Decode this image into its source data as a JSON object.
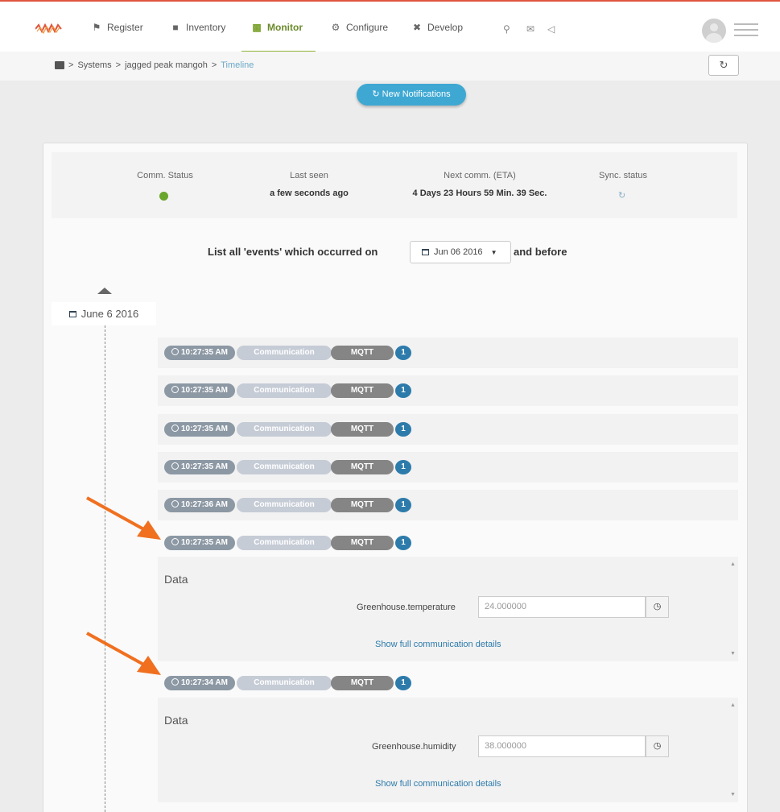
{
  "nav": {
    "items": [
      {
        "label": "Register",
        "icon": "flag-icon"
      },
      {
        "label": "Inventory",
        "icon": "box-icon"
      },
      {
        "label": "Monitor",
        "icon": "dashboard-icon"
      },
      {
        "label": "Configure",
        "icon": "gear-icon"
      },
      {
        "label": "Develop",
        "icon": "tools-icon"
      }
    ],
    "active": "Monitor",
    "accent": "#7ba22e"
  },
  "breadcrumb": {
    "sep": ">",
    "items": [
      "Systems",
      "jagged peak mangoh",
      "Timeline"
    ]
  },
  "notifications_button": "↻ New Notifications",
  "status": {
    "comm_label": "Comm. Status",
    "last_seen_label": "Last seen",
    "last_seen_value": "a few seconds ago",
    "next_comm_label": "Next comm. (ETA)",
    "next_comm_value": "4 Days 23 Hours 59 Min. 39 Sec.",
    "sync_label": "Sync. status",
    "comm_color": "#6aa52c"
  },
  "filter": {
    "prefix": "List all 'events' which occurred on",
    "date": "Jun 06 2016",
    "suffix": "and before"
  },
  "timeline": {
    "date_label": "June 6 2016",
    "events": [
      {
        "time": "10:27:35 AM",
        "type": "Communication",
        "protocol": "MQTT",
        "count": "1"
      },
      {
        "time": "10:27:35 AM",
        "type": "Communication",
        "protocol": "MQTT",
        "count": "1"
      },
      {
        "time": "10:27:35 AM",
        "type": "Communication",
        "protocol": "MQTT",
        "count": "1"
      },
      {
        "time": "10:27:35 AM",
        "type": "Communication",
        "protocol": "MQTT",
        "count": "1"
      },
      {
        "time": "10:27:36 AM",
        "type": "Communication",
        "protocol": "MQTT",
        "count": "1"
      },
      {
        "time": "10:27:35 AM",
        "type": "Communication",
        "protocol": "MQTT",
        "count": "1"
      },
      {
        "time": "10:27:34 AM",
        "type": "Communication",
        "protocol": "MQTT",
        "count": "1"
      }
    ],
    "details": [
      {
        "title": "Data",
        "field": "Greenhouse.temperature",
        "value": "24.000000",
        "link": "Show full communication details"
      },
      {
        "title": "Data",
        "field": "Greenhouse.humidity",
        "value": "38.000000",
        "link": "Show full communication details"
      }
    ]
  },
  "colors": {
    "top_border": "#e0543e",
    "button_blue": "#3ea8d3",
    "count_badge": "#2d7bab",
    "annotation_arrow": "#f07020"
  }
}
